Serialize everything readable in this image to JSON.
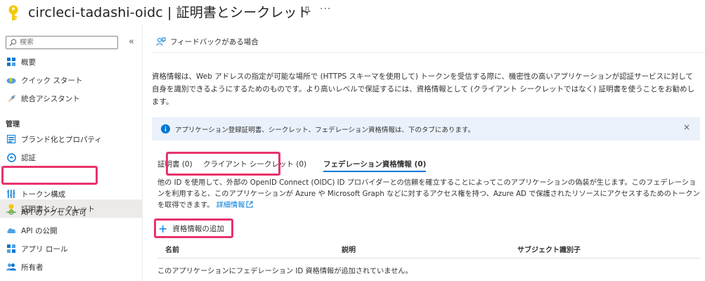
{
  "header": {
    "title": "circleci-tadashi-oidc | 証明書とシークレット",
    "more": "···"
  },
  "sidebar": {
    "search_placeholder": "検索",
    "collapse": "«",
    "items": [
      {
        "label": "概要",
        "icon": "grid-icon"
      },
      {
        "label": "クイック スタート",
        "icon": "cloud-lightning-icon"
      },
      {
        "label": "統合アシスタント",
        "icon": "rocket-icon"
      }
    ],
    "section_manage": "管理",
    "manage_items": [
      {
        "label": "ブランド化とプロパティ",
        "icon": "branding-icon"
      },
      {
        "label": "認証",
        "icon": "auth-icon"
      },
      {
        "label": "証明書とシークレット",
        "icon": "key-icon",
        "selected": true
      },
      {
        "label": "トークン構成",
        "icon": "token-icon"
      },
      {
        "label": "API のアクセス許可",
        "icon": "api-permission-icon"
      },
      {
        "label": "API の公開",
        "icon": "cloud-api-icon"
      },
      {
        "label": "アプリ ロール",
        "icon": "app-roles-icon"
      },
      {
        "label": "所有者",
        "icon": "owners-icon"
      }
    ]
  },
  "main": {
    "feedback": "フィードバックがある場合",
    "description": "資格情報は、Web アドレスの指定が可能な場所で (HTTPS スキーマを使用して) トークンを受信する際に、機密性の高いアプリケーションが認証サービスに対して自身を識別できるようにするためのものです。より高いレベルで保証するには、資格情報として (クライアント シークレットではなく) 証明書を使うことをお勧めします。",
    "info_banner": "アプリケーション登録証明書、シークレット、フェデレーション資格情報は、下のタブにあります。",
    "info_close": "×",
    "tabs": [
      {
        "label": "証明書 (0)"
      },
      {
        "label": "クライアント シークレット (0)"
      },
      {
        "label": "フェデレーション資格情報 (0)",
        "active": true
      }
    ],
    "fed_description": "他の ID を使用して、外部の OpenID Connect (OIDC) ID プロバイダーとの信頼を確立することによってこのアプリケーションの偽装が生じます。このフェデレーションを利用すると、このアプリケーションが Azure や Microsoft Graph などに対するアクセス権を持つ、Azure AD で保護されたリソースにアクセスするためのトークンを取得できます。",
    "learn_more": "詳細情報",
    "add_button": "資格情報の追加",
    "table": {
      "columns": [
        "名前",
        "説明",
        "サブジェクト識別子"
      ],
      "empty": "このアプリケーションにフェデレーション ID 資格情報が追加されていません。"
    }
  },
  "colors": {
    "accent": "#0078d4",
    "highlight": "#e8336b",
    "key": "#f2c80f"
  }
}
